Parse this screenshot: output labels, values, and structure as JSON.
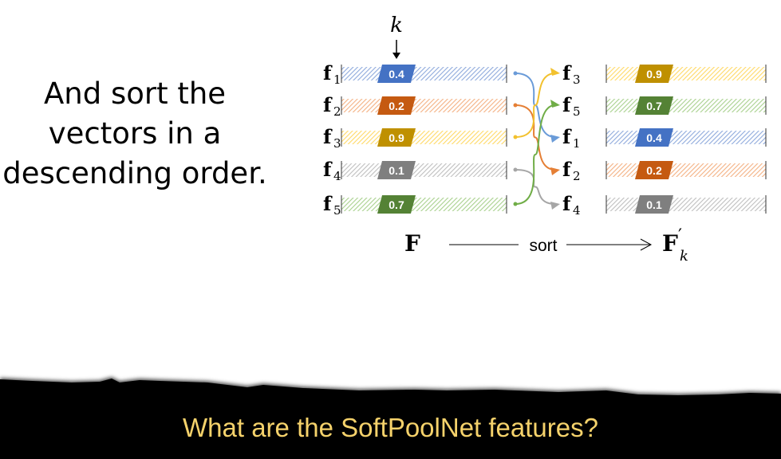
{
  "side_text": [
    "And sort the",
    "vectors in a",
    "descending order."
  ],
  "diagram": {
    "k_label": "k",
    "input_label": "F",
    "output_label": "F",
    "output_prime": "′",
    "output_subscript": "k",
    "sort_label": "sort",
    "left_rows": [
      {
        "name": "f",
        "index": "1",
        "value": "0.4",
        "color": "#4472C4",
        "light": "#8FAADC"
      },
      {
        "name": "f",
        "index": "2",
        "value": "0.2",
        "color": "#C55A11",
        "light": "#F4B183"
      },
      {
        "name": "f",
        "index": "3",
        "value": "0.9",
        "color": "#BF9000",
        "light": "#FFD966"
      },
      {
        "name": "f",
        "index": "4",
        "value": "0.1",
        "color": "#7F7F7F",
        "light": "#BFBFBF"
      },
      {
        "name": "f",
        "index": "5",
        "value": "0.7",
        "color": "#548235",
        "light": "#A9D18E"
      }
    ],
    "right_rows": [
      {
        "name": "f",
        "index": "3",
        "value": "0.9",
        "color": "#BF9000",
        "light": "#FFD966"
      },
      {
        "name": "f",
        "index": "5",
        "value": "0.7",
        "color": "#548235",
        "light": "#A9D18E"
      },
      {
        "name": "f",
        "index": "1",
        "value": "0.4",
        "color": "#4472C4",
        "light": "#8FAADC"
      },
      {
        "name": "f",
        "index": "2",
        "value": "0.2",
        "color": "#C55A11",
        "light": "#F4B183"
      },
      {
        "name": "f",
        "index": "4",
        "value": "0.1",
        "color": "#7F7F7F",
        "light": "#BFBFBF"
      }
    ],
    "mapping": [
      2,
      3,
      0,
      4,
      1
    ],
    "arrow_colors": [
      "#6A9BD8",
      "#E57F35",
      "#F2C12E",
      "#A6A6A6",
      "#70AD47"
    ]
  },
  "footer": {
    "title": "What are the SoftPoolNet features?",
    "title_color": "#F5D26B"
  }
}
